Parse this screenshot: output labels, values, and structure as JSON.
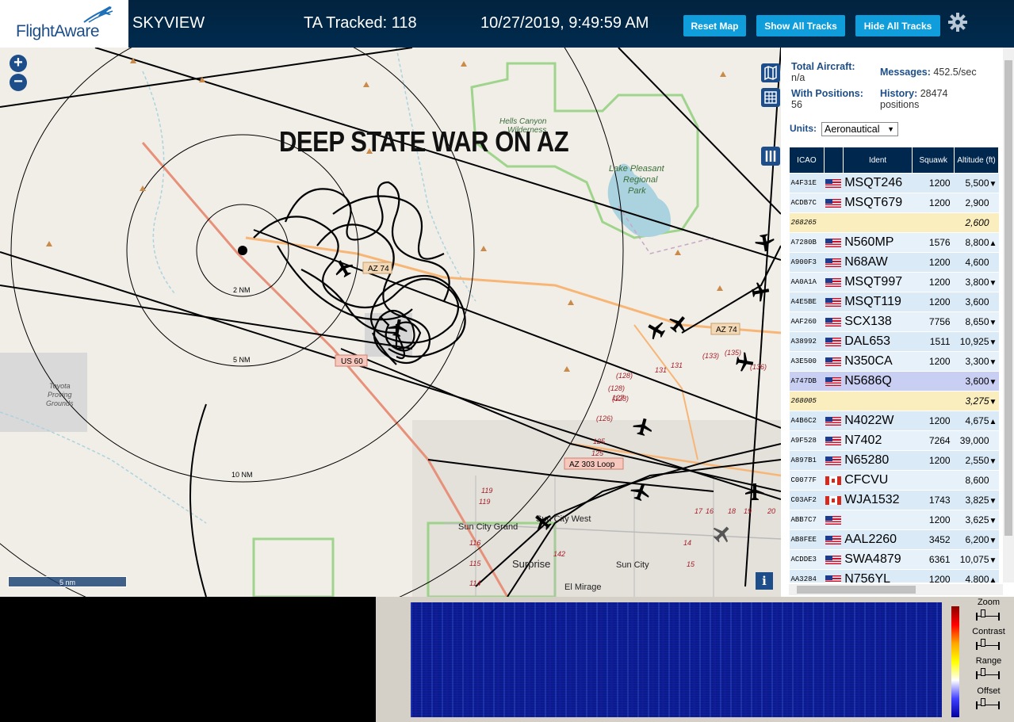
{
  "header": {
    "logo_text": "FlightAware",
    "app_name": "SKYVIEW",
    "tracked_label": "TA Tracked: 118",
    "datetime": "10/27/2019, 9:49:59 AM",
    "buttons": {
      "reset_map": "Reset Map",
      "show_all_tracks": "Show All Tracks",
      "hide_all_tracks": "Hide All Tracks"
    },
    "settings_icon": "gear-icon"
  },
  "map": {
    "overlay_title": "DEEP STATE WAR ON AZ",
    "zoom_in": "+",
    "zoom_out": "−",
    "scale_label": "5 nm",
    "info_label": "i",
    "range_rings": [
      "2 NM",
      "5 NM",
      "10 NM"
    ],
    "place_labels": {
      "hells_canyon": "Hells Canyon\nWilderness",
      "lake_pleasant": "Lake Pleasant\nRegional\nPark",
      "toyota": "Toyota\nProving\nGrounds",
      "sun_city_grand": "Sun City Grand",
      "sun_city_west": "Sun City West",
      "surprise": "Surprise",
      "sun_city": "Sun City",
      "el_mirage": "El Mirage"
    },
    "road_shields": [
      "AZ 74",
      "AZ 74",
      "US 60",
      "AZ 303 Loop"
    ],
    "road_numbers": [
      "(128)",
      "131",
      "131",
      "(133)",
      "(135)",
      "(136)",
      "(128)",
      "(128)",
      "127",
      "(126)",
      "125",
      "125",
      "119",
      "119",
      "116",
      "115",
      "114",
      "142",
      "17",
      "16",
      "18",
      "19",
      "20",
      "14",
      "15"
    ],
    "colors": {
      "land": "#f1eee8",
      "park_border": "#8fcf7a",
      "water": "#aad3df",
      "track": "#000000",
      "road_primary": "#f7b676",
      "road_secondary": "#c0c0c0"
    }
  },
  "panel": {
    "total_aircraft_label": "Total Aircraft:",
    "total_aircraft_value": "n/a",
    "with_positions_label": "With Positions:",
    "with_positions_value": "56",
    "messages_label": "Messages:",
    "messages_value": "452.5/sec",
    "history_label": "History:",
    "history_value": "28474 positions",
    "units_label": "Units:",
    "units_value": "Aeronautical",
    "columns": [
      "ICAO",
      "",
      "Ident",
      "Squawk",
      "Altitude (ft)"
    ],
    "rows": [
      {
        "icao": "A4F31E",
        "flag": "US",
        "ident": "MSQT246",
        "squawk": "1200",
        "alt": "5,500",
        "trend": "▼",
        "type": "normal"
      },
      {
        "icao": "ACDB7C",
        "flag": "US",
        "ident": "MSQT679",
        "squawk": "1200",
        "alt": "2,900",
        "trend": "",
        "type": "normal"
      },
      {
        "icao": "268265",
        "flag": "",
        "ident": "",
        "squawk": "",
        "alt": "2,600",
        "trend": "",
        "type": "mlat"
      },
      {
        "icao": "A7280B",
        "flag": "US",
        "ident": "N560MP",
        "squawk": "1576",
        "alt": "8,800",
        "trend": "▲",
        "type": "normal"
      },
      {
        "icao": "A900F3",
        "flag": "US",
        "ident": "N68AW",
        "squawk": "1200",
        "alt": "4,600",
        "trend": "",
        "type": "normal"
      },
      {
        "icao": "AA0A1A",
        "flag": "US",
        "ident": "MSQT997",
        "squawk": "1200",
        "alt": "3,800",
        "trend": "▼",
        "type": "normal"
      },
      {
        "icao": "A4E5BE",
        "flag": "US",
        "ident": "MSQT119",
        "squawk": "1200",
        "alt": "3,600",
        "trend": "",
        "type": "normal"
      },
      {
        "icao": "AAF260",
        "flag": "US",
        "ident": "SCX138",
        "squawk": "7756",
        "alt": "8,650",
        "trend": "▼",
        "type": "normal"
      },
      {
        "icao": "A38992",
        "flag": "US",
        "ident": "DAL653",
        "squawk": "1511",
        "alt": "10,925",
        "trend": "▼",
        "type": "normal"
      },
      {
        "icao": "A3E500",
        "flag": "US",
        "ident": "N350CA",
        "squawk": "1200",
        "alt": "3,300",
        "trend": "▼",
        "type": "normal"
      },
      {
        "icao": "A747DB",
        "flag": "US",
        "ident": "N5686Q",
        "squawk": "",
        "alt": "3,600",
        "trend": "▼",
        "type": "selected"
      },
      {
        "icao": "268005",
        "flag": "",
        "ident": "",
        "squawk": "",
        "alt": "3,275",
        "trend": "▼",
        "type": "mlat"
      },
      {
        "icao": "A4B6C2",
        "flag": "US",
        "ident": "N4022W",
        "squawk": "1200",
        "alt": "4,675",
        "trend": "▲",
        "type": "normal"
      },
      {
        "icao": "A9F528",
        "flag": "US",
        "ident": "N7402",
        "squawk": "7264",
        "alt": "39,000",
        "trend": "",
        "type": "normal"
      },
      {
        "icao": "A897B1",
        "flag": "US",
        "ident": "N65280",
        "squawk": "1200",
        "alt": "2,550",
        "trend": "▼",
        "type": "normal"
      },
      {
        "icao": "C0077F",
        "flag": "CA",
        "ident": "CFCVU",
        "squawk": "",
        "alt": "8,600",
        "trend": "",
        "type": "normal"
      },
      {
        "icao": "C03AF2",
        "flag": "CA",
        "ident": "WJA1532",
        "squawk": "1743",
        "alt": "3,825",
        "trend": "▼",
        "type": "normal"
      },
      {
        "icao": "ABB7C7",
        "flag": "US",
        "ident": "",
        "squawk": "1200",
        "alt": "3,625",
        "trend": "▼",
        "type": "normal"
      },
      {
        "icao": "AB8FEE",
        "flag": "US",
        "ident": "AAL2260",
        "squawk": "3452",
        "alt": "6,200",
        "trend": "▼",
        "type": "normal"
      },
      {
        "icao": "ACDDE3",
        "flag": "US",
        "ident": "SWA4879",
        "squawk": "6361",
        "alt": "10,075",
        "trend": "▼",
        "type": "normal"
      },
      {
        "icao": "AA3284",
        "flag": "US",
        "ident": "N756YL",
        "squawk": "1200",
        "alt": "4,800",
        "trend": "▲",
        "type": "normal"
      }
    ]
  },
  "waterfall": {
    "controls": [
      "Zoom",
      "Contrast",
      "Range",
      "Offset"
    ]
  }
}
